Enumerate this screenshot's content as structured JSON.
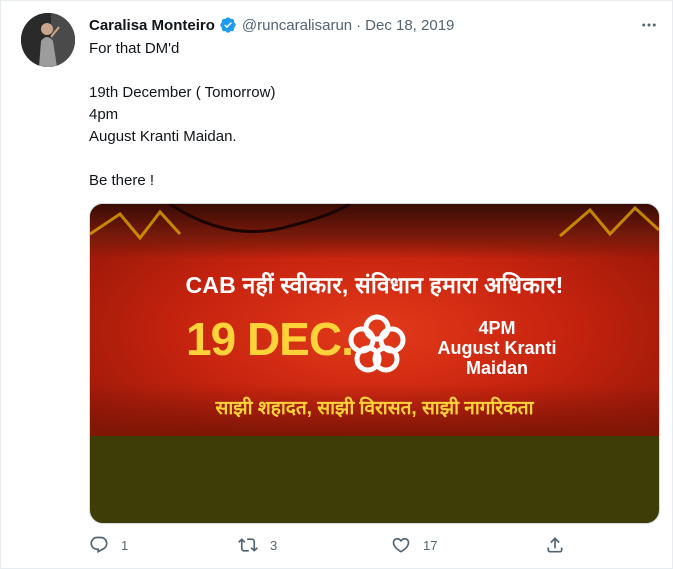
{
  "tweet": {
    "author_name": "Caralisa Monteiro",
    "handle": "@runcaralisarun",
    "separator": "·",
    "date": "Dec 18, 2019",
    "lines": [
      "For that DM'd",
      "19th December ( Tomorrow)",
      "4pm",
      "August Kranti Maidan.",
      "Be there !"
    ]
  },
  "media": {
    "headline": "CAB नहीं स्वीकार, संविधान हमारा अधिकार!",
    "date_big": "19 DEC.",
    "venue_time": "4PM",
    "venue_name_1": "August Kranti",
    "venue_name_2": "Maidan",
    "tagline": "साझी शहादत, साझी विरासत, साझी नागरिकता"
  },
  "actions": {
    "reply_count": "1",
    "retweet_count": "3",
    "like_count": "17"
  },
  "colors": {
    "text": "#0f1419",
    "secondary": "#536471",
    "verified": "#1d9bf0",
    "banner_red": "#c8240f",
    "banner_yellow": "#ffd23a",
    "media_bottom": "#3e3c07"
  },
  "icons": [
    "verified-badge-icon",
    "more-icon",
    "reply-icon",
    "retweet-icon",
    "like-icon",
    "share-icon"
  ]
}
